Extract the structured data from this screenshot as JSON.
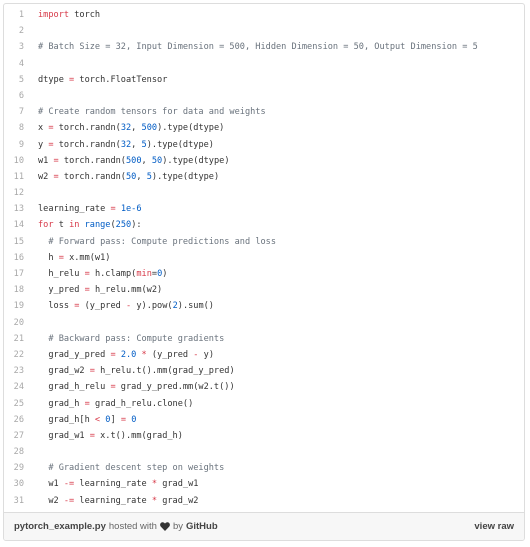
{
  "code": {
    "lines": [
      [
        {
          "t": "import",
          "c": "k"
        },
        {
          "t": " torch"
        }
      ],
      [],
      [
        {
          "t": "# Batch Size = 32, Input Dimension = 500, Hidden Dimension = 50, Output Dimension = 5",
          "c": "c"
        }
      ],
      [],
      [
        {
          "t": "dtype "
        },
        {
          "t": "=",
          "c": "k"
        },
        {
          "t": " torch.FloatTensor"
        }
      ],
      [],
      [
        {
          "t": "# Create random tensors for data and weights",
          "c": "c"
        }
      ],
      [
        {
          "t": "x "
        },
        {
          "t": "=",
          "c": "k"
        },
        {
          "t": " torch.randn("
        },
        {
          "t": "32",
          "c": "n"
        },
        {
          "t": ", "
        },
        {
          "t": "500",
          "c": "n"
        },
        {
          "t": ").type(dtype)"
        }
      ],
      [
        {
          "t": "y "
        },
        {
          "t": "=",
          "c": "k"
        },
        {
          "t": " torch.randn("
        },
        {
          "t": "32",
          "c": "n"
        },
        {
          "t": ", "
        },
        {
          "t": "5",
          "c": "n"
        },
        {
          "t": ").type(dtype)"
        }
      ],
      [
        {
          "t": "w1 "
        },
        {
          "t": "=",
          "c": "k"
        },
        {
          "t": " torch.randn("
        },
        {
          "t": "500",
          "c": "n"
        },
        {
          "t": ", "
        },
        {
          "t": "50",
          "c": "n"
        },
        {
          "t": ").type(dtype)"
        }
      ],
      [
        {
          "t": "w2 "
        },
        {
          "t": "=",
          "c": "k"
        },
        {
          "t": " torch.randn("
        },
        {
          "t": "50",
          "c": "n"
        },
        {
          "t": ", "
        },
        {
          "t": "5",
          "c": "n"
        },
        {
          "t": ").type(dtype)"
        }
      ],
      [],
      [
        {
          "t": "learning_rate "
        },
        {
          "t": "=",
          "c": "k"
        },
        {
          "t": " "
        },
        {
          "t": "1e-6",
          "c": "n"
        }
      ],
      [
        {
          "t": "for",
          "c": "k"
        },
        {
          "t": " t "
        },
        {
          "t": "in",
          "c": "k"
        },
        {
          "t": " "
        },
        {
          "t": "range",
          "c": "b"
        },
        {
          "t": "("
        },
        {
          "t": "250",
          "c": "n"
        },
        {
          "t": "):"
        }
      ],
      [
        {
          "t": "  "
        },
        {
          "t": "# Forward pass: Compute predictions and loss",
          "c": "c"
        }
      ],
      [
        {
          "t": "  h "
        },
        {
          "t": "=",
          "c": "k"
        },
        {
          "t": " x.mm(w1)"
        }
      ],
      [
        {
          "t": "  h_relu "
        },
        {
          "t": "=",
          "c": "k"
        },
        {
          "t": " h.clamp("
        },
        {
          "t": "min",
          "c": "k"
        },
        {
          "t": "="
        },
        {
          "t": "0",
          "c": "n"
        },
        {
          "t": ")"
        }
      ],
      [
        {
          "t": "  y_pred "
        },
        {
          "t": "=",
          "c": "k"
        },
        {
          "t": " h_relu.mm(w2)"
        }
      ],
      [
        {
          "t": "  loss "
        },
        {
          "t": "=",
          "c": "k"
        },
        {
          "t": " (y_pred "
        },
        {
          "t": "-",
          "c": "k"
        },
        {
          "t": " y).pow("
        },
        {
          "t": "2",
          "c": "n"
        },
        {
          "t": ").sum()"
        }
      ],
      [],
      [
        {
          "t": "  "
        },
        {
          "t": "# Backward pass: Compute gradients",
          "c": "c"
        }
      ],
      [
        {
          "t": "  grad_y_pred "
        },
        {
          "t": "=",
          "c": "k"
        },
        {
          "t": " "
        },
        {
          "t": "2.0",
          "c": "n"
        },
        {
          "t": " "
        },
        {
          "t": "*",
          "c": "k"
        },
        {
          "t": " (y_pred "
        },
        {
          "t": "-",
          "c": "k"
        },
        {
          "t": " y)"
        }
      ],
      [
        {
          "t": "  grad_w2 "
        },
        {
          "t": "=",
          "c": "k"
        },
        {
          "t": " h_relu.t().mm(grad_y_pred)"
        }
      ],
      [
        {
          "t": "  grad_h_relu "
        },
        {
          "t": "=",
          "c": "k"
        },
        {
          "t": " grad_y_pred.mm(w2.t())"
        }
      ],
      [
        {
          "t": "  grad_h "
        },
        {
          "t": "=",
          "c": "k"
        },
        {
          "t": " grad_h_relu.clone()"
        }
      ],
      [
        {
          "t": "  grad_h[h "
        },
        {
          "t": "<",
          "c": "k"
        },
        {
          "t": " "
        },
        {
          "t": "0",
          "c": "n"
        },
        {
          "t": "] "
        },
        {
          "t": "=",
          "c": "k"
        },
        {
          "t": " "
        },
        {
          "t": "0",
          "c": "n"
        }
      ],
      [
        {
          "t": "  grad_w1 "
        },
        {
          "t": "=",
          "c": "k"
        },
        {
          "t": " x.t().mm(grad_h)"
        }
      ],
      [],
      [
        {
          "t": "  "
        },
        {
          "t": "# Gradient descent step on weights",
          "c": "c"
        }
      ],
      [
        {
          "t": "  w1 "
        },
        {
          "t": "-=",
          "c": "k"
        },
        {
          "t": " learning_rate "
        },
        {
          "t": "*",
          "c": "k"
        },
        {
          "t": " grad_w1"
        }
      ],
      [
        {
          "t": "  w2 "
        },
        {
          "t": "-=",
          "c": "k"
        },
        {
          "t": " learning_rate "
        },
        {
          "t": "*",
          "c": "k"
        },
        {
          "t": " grad_w2"
        }
      ]
    ]
  },
  "footer": {
    "filename": "pytorch_example.py",
    "hosted_with": "hosted with",
    "by": "by",
    "github": "GitHub",
    "view_raw": "view raw",
    "heart_icon": "heart-icon"
  }
}
